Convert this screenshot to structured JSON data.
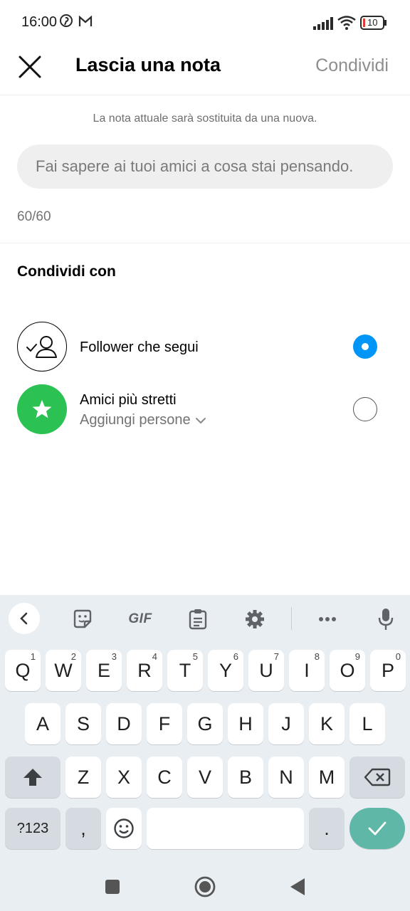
{
  "status_bar": {
    "time": "16:00",
    "battery": "10",
    "icons": [
      "pinterest-icon",
      "gmail-icon",
      "signal-icon",
      "wifi-icon",
      "battery-icon"
    ]
  },
  "header": {
    "title": "Lascia una nota",
    "share_label": "Condividi",
    "close_icon": "close-icon"
  },
  "note": {
    "hint": "La nota attuale sarà sostituita da una nuova.",
    "placeholder": "Fai sapere ai tuoi amici a cosa stai pensando.",
    "counter": "60/60"
  },
  "share_with": {
    "title": "Condividi con",
    "options": [
      {
        "label": "Follower che segui",
        "selected": true,
        "icon": "followers-check-icon"
      },
      {
        "label": "Amici più stretti",
        "sublabel": "Aggiungi persone",
        "selected": false,
        "icon": "star-icon"
      }
    ]
  },
  "keyboard": {
    "toolbar": [
      "back-icon",
      "sticker-icon",
      "GIF",
      "clipboard-icon",
      "gear-icon",
      "more-icon",
      "mic-icon"
    ],
    "gif_label": "GIF",
    "row1": [
      {
        "k": "Q",
        "s": "1"
      },
      {
        "k": "W",
        "s": "2"
      },
      {
        "k": "E",
        "s": "3"
      },
      {
        "k": "R",
        "s": "4"
      },
      {
        "k": "T",
        "s": "5"
      },
      {
        "k": "Y",
        "s": "6"
      },
      {
        "k": "U",
        "s": "7"
      },
      {
        "k": "I",
        "s": "8"
      },
      {
        "k": "O",
        "s": "9"
      },
      {
        "k": "P",
        "s": "0"
      }
    ],
    "row2": [
      "A",
      "S",
      "D",
      "F",
      "G",
      "H",
      "J",
      "K",
      "L"
    ],
    "row3": [
      "Z",
      "X",
      "C",
      "V",
      "B",
      "N",
      "M"
    ],
    "symbols_label": "?123",
    "comma_label": ",",
    "period_label": ".",
    "accent_color": "#5fb7a8"
  },
  "nav_bar": [
    "recents-icon",
    "home-icon",
    "back-icon"
  ],
  "colors": {
    "primary_blue": "#0095f6",
    "close_friends_green": "#2bc253"
  }
}
